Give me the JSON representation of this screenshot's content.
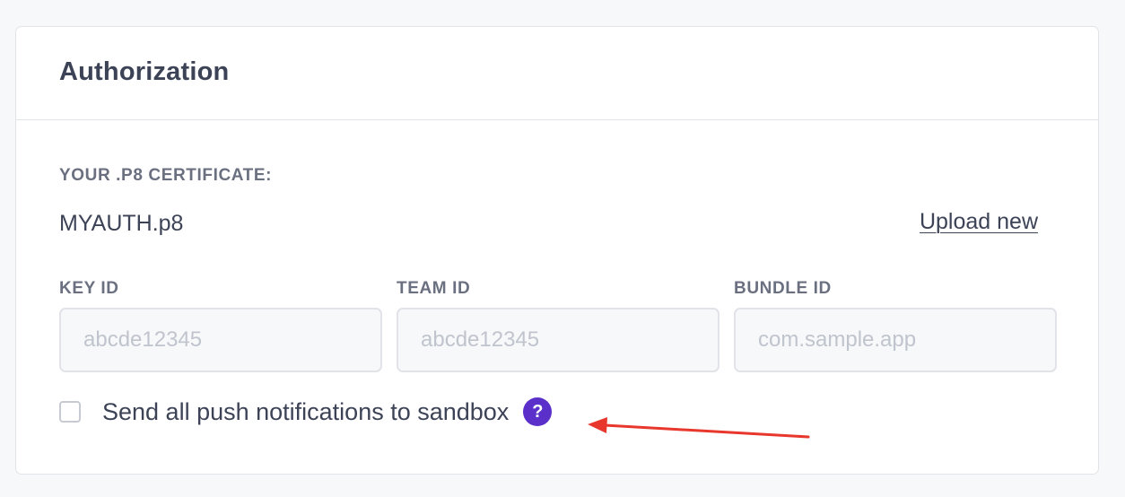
{
  "authorization": {
    "title": "Authorization",
    "certificate": {
      "label": "YOUR .P8 CERTIFICATE:",
      "filename": "MYAUTH.p8",
      "upload_label": "Upload new"
    },
    "fields": {
      "key_id": {
        "label": "KEY ID",
        "value": "",
        "placeholder": "abcde12345"
      },
      "team_id": {
        "label": "TEAM ID",
        "value": "",
        "placeholder": "abcde12345"
      },
      "bundle_id": {
        "label": "BUNDLE ID",
        "value": "",
        "placeholder": "com.sample.app"
      }
    },
    "sandbox": {
      "label": "Send all push notifications to sandbox",
      "checked": false,
      "help_icon_glyph": "?"
    }
  },
  "colors": {
    "accent": "#5b2fc9",
    "annotation_arrow": "#e8372c",
    "page_background": "#f7f8fa",
    "text": "#3d4356",
    "muted_label": "#6b7080"
  },
  "icons": {
    "help": "question-circle-icon",
    "annotation": "red-arrow-annotation"
  }
}
